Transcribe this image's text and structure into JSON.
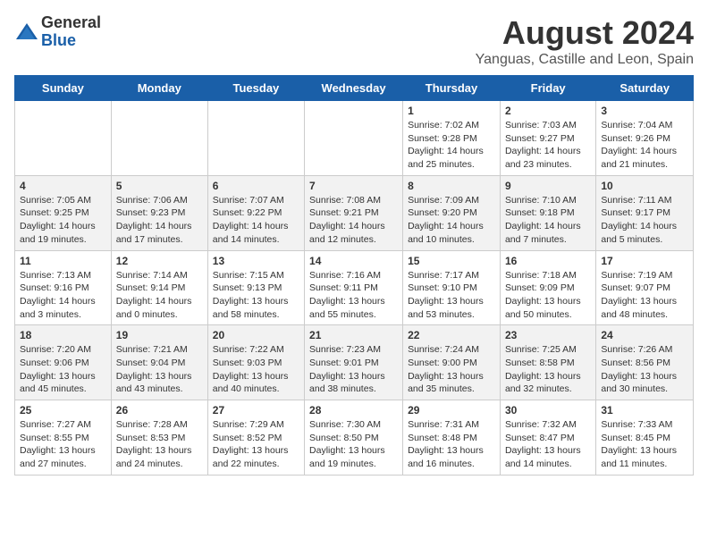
{
  "header": {
    "logo_general": "General",
    "logo_blue": "Blue",
    "title": "August 2024",
    "location": "Yanguas, Castille and Leon, Spain"
  },
  "weekdays": [
    "Sunday",
    "Monday",
    "Tuesday",
    "Wednesday",
    "Thursday",
    "Friday",
    "Saturday"
  ],
  "weeks": [
    [
      {
        "day": "",
        "content": ""
      },
      {
        "day": "",
        "content": ""
      },
      {
        "day": "",
        "content": ""
      },
      {
        "day": "",
        "content": ""
      },
      {
        "day": "1",
        "content": "Sunrise: 7:02 AM\nSunset: 9:28 PM\nDaylight: 14 hours\nand 25 minutes."
      },
      {
        "day": "2",
        "content": "Sunrise: 7:03 AM\nSunset: 9:27 PM\nDaylight: 14 hours\nand 23 minutes."
      },
      {
        "day": "3",
        "content": "Sunrise: 7:04 AM\nSunset: 9:26 PM\nDaylight: 14 hours\nand 21 minutes."
      }
    ],
    [
      {
        "day": "4",
        "content": "Sunrise: 7:05 AM\nSunset: 9:25 PM\nDaylight: 14 hours\nand 19 minutes."
      },
      {
        "day": "5",
        "content": "Sunrise: 7:06 AM\nSunset: 9:23 PM\nDaylight: 14 hours\nand 17 minutes."
      },
      {
        "day": "6",
        "content": "Sunrise: 7:07 AM\nSunset: 9:22 PM\nDaylight: 14 hours\nand 14 minutes."
      },
      {
        "day": "7",
        "content": "Sunrise: 7:08 AM\nSunset: 9:21 PM\nDaylight: 14 hours\nand 12 minutes."
      },
      {
        "day": "8",
        "content": "Sunrise: 7:09 AM\nSunset: 9:20 PM\nDaylight: 14 hours\nand 10 minutes."
      },
      {
        "day": "9",
        "content": "Sunrise: 7:10 AM\nSunset: 9:18 PM\nDaylight: 14 hours\nand 7 minutes."
      },
      {
        "day": "10",
        "content": "Sunrise: 7:11 AM\nSunset: 9:17 PM\nDaylight: 14 hours\nand 5 minutes."
      }
    ],
    [
      {
        "day": "11",
        "content": "Sunrise: 7:13 AM\nSunset: 9:16 PM\nDaylight: 14 hours\nand 3 minutes."
      },
      {
        "day": "12",
        "content": "Sunrise: 7:14 AM\nSunset: 9:14 PM\nDaylight: 14 hours\nand 0 minutes."
      },
      {
        "day": "13",
        "content": "Sunrise: 7:15 AM\nSunset: 9:13 PM\nDaylight: 13 hours\nand 58 minutes."
      },
      {
        "day": "14",
        "content": "Sunrise: 7:16 AM\nSunset: 9:11 PM\nDaylight: 13 hours\nand 55 minutes."
      },
      {
        "day": "15",
        "content": "Sunrise: 7:17 AM\nSunset: 9:10 PM\nDaylight: 13 hours\nand 53 minutes."
      },
      {
        "day": "16",
        "content": "Sunrise: 7:18 AM\nSunset: 9:09 PM\nDaylight: 13 hours\nand 50 minutes."
      },
      {
        "day": "17",
        "content": "Sunrise: 7:19 AM\nSunset: 9:07 PM\nDaylight: 13 hours\nand 48 minutes."
      }
    ],
    [
      {
        "day": "18",
        "content": "Sunrise: 7:20 AM\nSunset: 9:06 PM\nDaylight: 13 hours\nand 45 minutes."
      },
      {
        "day": "19",
        "content": "Sunrise: 7:21 AM\nSunset: 9:04 PM\nDaylight: 13 hours\nand 43 minutes."
      },
      {
        "day": "20",
        "content": "Sunrise: 7:22 AM\nSunset: 9:03 PM\nDaylight: 13 hours\nand 40 minutes."
      },
      {
        "day": "21",
        "content": "Sunrise: 7:23 AM\nSunset: 9:01 PM\nDaylight: 13 hours\nand 38 minutes."
      },
      {
        "day": "22",
        "content": "Sunrise: 7:24 AM\nSunset: 9:00 PM\nDaylight: 13 hours\nand 35 minutes."
      },
      {
        "day": "23",
        "content": "Sunrise: 7:25 AM\nSunset: 8:58 PM\nDaylight: 13 hours\nand 32 minutes."
      },
      {
        "day": "24",
        "content": "Sunrise: 7:26 AM\nSunset: 8:56 PM\nDaylight: 13 hours\nand 30 minutes."
      }
    ],
    [
      {
        "day": "25",
        "content": "Sunrise: 7:27 AM\nSunset: 8:55 PM\nDaylight: 13 hours\nand 27 minutes."
      },
      {
        "day": "26",
        "content": "Sunrise: 7:28 AM\nSunset: 8:53 PM\nDaylight: 13 hours\nand 24 minutes."
      },
      {
        "day": "27",
        "content": "Sunrise: 7:29 AM\nSunset: 8:52 PM\nDaylight: 13 hours\nand 22 minutes."
      },
      {
        "day": "28",
        "content": "Sunrise: 7:30 AM\nSunset: 8:50 PM\nDaylight: 13 hours\nand 19 minutes."
      },
      {
        "day": "29",
        "content": "Sunrise: 7:31 AM\nSunset: 8:48 PM\nDaylight: 13 hours\nand 16 minutes."
      },
      {
        "day": "30",
        "content": "Sunrise: 7:32 AM\nSunset: 8:47 PM\nDaylight: 13 hours\nand 14 minutes."
      },
      {
        "day": "31",
        "content": "Sunrise: 7:33 AM\nSunset: 8:45 PM\nDaylight: 13 hours\nand 11 minutes."
      }
    ]
  ]
}
